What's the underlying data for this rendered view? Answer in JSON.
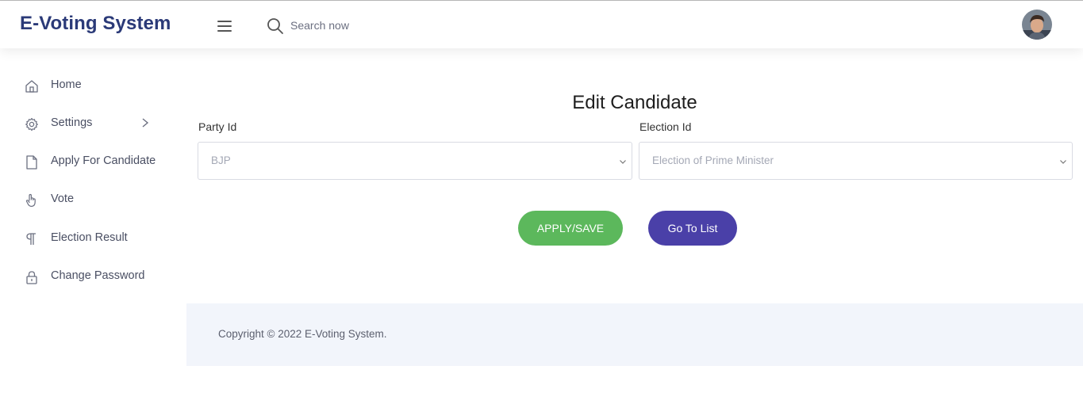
{
  "app": {
    "brand": "E-Voting System"
  },
  "header": {
    "search_placeholder": "Search now"
  },
  "sidebar": {
    "items": [
      {
        "label": "Home",
        "icon": "home-icon"
      },
      {
        "label": "Settings",
        "icon": "gear-icon",
        "has_submenu": true
      },
      {
        "label": "Apply For Candidate",
        "icon": "file-icon"
      },
      {
        "label": "Vote",
        "icon": "hand-pointer-icon"
      },
      {
        "label": "Election Result",
        "icon": "paragraph-icon"
      },
      {
        "label": "Change Password",
        "icon": "lock-icon"
      }
    ]
  },
  "main": {
    "title": "Edit Candidate",
    "party": {
      "label": "Party Id",
      "value": "BJP"
    },
    "election": {
      "label": "Election Id",
      "value": "Election of Prime Minister"
    },
    "save_label": "APPLY/SAVE",
    "list_label": "Go To List"
  },
  "footer": {
    "copyright": "Copyright © 2022 E-Voting System."
  },
  "colors": {
    "brand": "#2b3a78",
    "save": "#5cb85c",
    "list": "#4a40a8",
    "footer_bg": "#f2f5fb"
  }
}
